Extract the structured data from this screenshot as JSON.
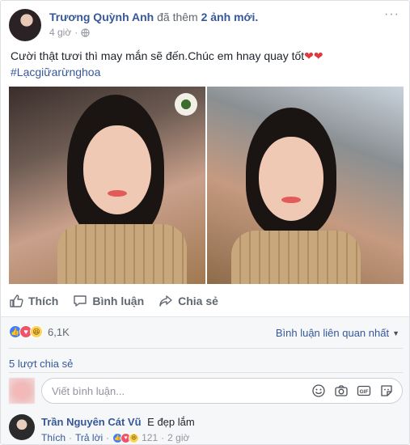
{
  "post": {
    "author": "Trương Quỳnh Anh",
    "action": "đã thêm",
    "action_count": "2 ảnh mới.",
    "time": "4 giờ",
    "more": "···",
    "text": "Cười thật tươi thì may mắn sẽ đến.Chúc em hnay quay tốt",
    "hearts": "❤❤",
    "hashtag": "#Lạcgiữarừnghoa"
  },
  "actions": {
    "like": "Thích",
    "comment": "Bình luận",
    "share": "Chia sẻ"
  },
  "reactions": {
    "count": "6,1K",
    "sort_label": "Bình luận liên quan nhất",
    "shares": "5 lượt chia sẻ"
  },
  "composer": {
    "placeholder": "Viết bình luận...",
    "gif": "GIF"
  },
  "comment": {
    "author": "Trần Nguyên Cát Vũ",
    "text": "E đẹp lắm",
    "like": "Thích",
    "reply": "Trả lời",
    "reaction_count": "121",
    "time": "2 giờ"
  },
  "colors": {
    "link": "#365899",
    "meta": "#90949c",
    "like_blue": "#4080ff",
    "love_red": "#f25268",
    "haha_yellow": "#fcd353"
  }
}
